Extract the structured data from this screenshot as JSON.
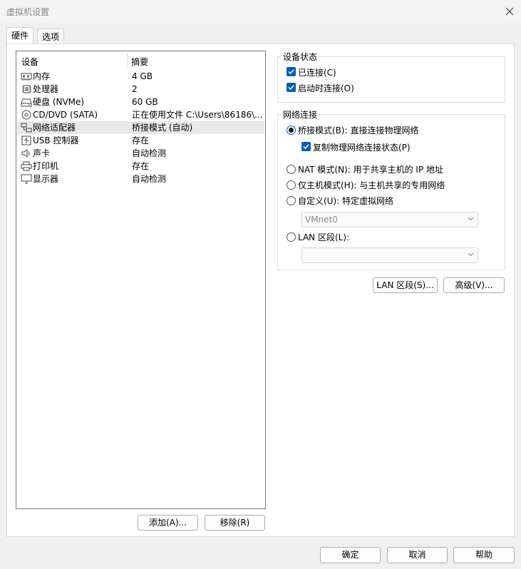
{
  "window": {
    "title": "虚拟机设置"
  },
  "tabs": [
    {
      "label": "硬件",
      "active": true
    },
    {
      "label": "选项",
      "active": false
    }
  ],
  "device_list": {
    "headers": {
      "device": "设备",
      "summary": "摘要"
    },
    "rows": [
      {
        "icon": "memory-icon",
        "name": "内存",
        "summary": "4 GB"
      },
      {
        "icon": "processor-icon",
        "name": "处理器",
        "summary": "2"
      },
      {
        "icon": "disk-icon",
        "name": "硬盘 (NVMe)",
        "summary": "60 GB"
      },
      {
        "icon": "cd-dvd-icon",
        "name": "CD/DVD (SATA)",
        "summary": "正在使用文件 C:\\Users\\86186\\..."
      },
      {
        "icon": "network-adapter-icon",
        "name": "网络适配器",
        "summary": "桥接模式 (自动)",
        "selected": true
      },
      {
        "icon": "usb-icon",
        "name": "USB 控制器",
        "summary": "存在"
      },
      {
        "icon": "sound-icon",
        "name": "声卡",
        "summary": "自动检测"
      },
      {
        "icon": "printer-icon",
        "name": "打印机",
        "summary": "存在"
      },
      {
        "icon": "display-icon",
        "name": "显示器",
        "summary": "自动检测"
      }
    ],
    "add_button": "添加(A)...",
    "remove_button": "移除(R)"
  },
  "device_status": {
    "title": "设备状态",
    "connected": {
      "label": "已连接(C)",
      "checked": true
    },
    "connect_on_start": {
      "label": "启动时连接(O)",
      "checked": true
    }
  },
  "network": {
    "title": "网络连接",
    "bridged": {
      "label": "桥接模式(B): 直接连接物理网络",
      "selected": true
    },
    "replicate": {
      "label": "复制物理网络连接状态(P)",
      "checked": true
    },
    "nat": {
      "label": "NAT 模式(N): 用于共享主机的 IP 地址",
      "selected": false
    },
    "host_only": {
      "label": "仅主机模式(H): 与主机共享的专用网络",
      "selected": false
    },
    "custom": {
      "label": "自定义(U): 特定虚拟网络",
      "selected": false
    },
    "custom_select": "VMnet0",
    "lan_segment": {
      "label": "LAN 区段(L):",
      "selected": false
    },
    "lan_select": ""
  },
  "side_buttons": {
    "lan_segments": "LAN 区段(S)...",
    "advanced": "高级(V)..."
  },
  "footer": {
    "ok": "确定",
    "cancel": "取消",
    "help": "帮助"
  },
  "colors": {
    "accent": "#005fb8",
    "selected_row": "#e8e8e8"
  }
}
